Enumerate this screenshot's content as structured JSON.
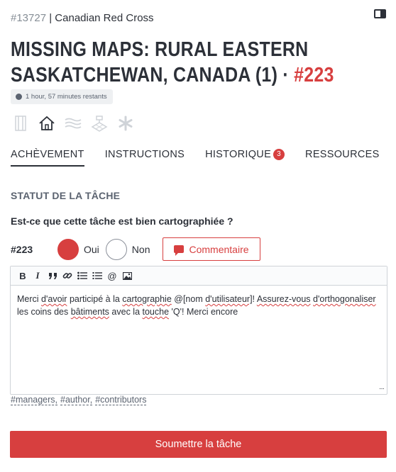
{
  "header": {
    "project_id": "#13727",
    "separator": " | ",
    "organization": "Canadian Red Cross"
  },
  "title": {
    "text": "MISSING MAPS: RURAL EASTERN SASKATCHEWAN, CANADA (1)",
    "dot": " · ",
    "task_number": "#223"
  },
  "timer": {
    "text": "1 hour, 57 minutes restants"
  },
  "icons": [
    "sidebar-icon",
    "home-icon",
    "waves-icon",
    "terrain-icon",
    "asterisk-icon"
  ],
  "tabs": [
    {
      "label": "ACHÈVEMENT",
      "active": true
    },
    {
      "label": "INSTRUCTIONS",
      "active": false
    },
    {
      "label": "HISTORIQUE",
      "badge": "3",
      "active": false
    },
    {
      "label": "RESSOURCES",
      "active": false
    }
  ],
  "status": {
    "section_title": "STATUT DE LA TÂCHE",
    "question": "Est-ce que cette tâche est bien cartographiée ?",
    "task_id": "#223",
    "yes_label": "Oui",
    "no_label": "Non",
    "selected": "Oui",
    "comment_label": "Commentaire"
  },
  "editor": {
    "toolbar": [
      "B",
      "I",
      "99",
      "link",
      "bulleted-list",
      "numbered-list",
      "@",
      "image"
    ],
    "segments": [
      {
        "t": "Merci "
      },
      {
        "t": "d'avoir",
        "spell": true
      },
      {
        "t": " participé à la "
      },
      {
        "t": "cartographie",
        "spell": true
      },
      {
        "t": " @[nom "
      },
      {
        "t": "d'utilisateur]",
        "spell": true
      },
      {
        "t": "! "
      },
      {
        "t": "Assurez-vous",
        "spell": true
      },
      {
        "t": " "
      },
      {
        "t": "d'orthogonaliser",
        "spell": true
      },
      {
        "t": " les coins des "
      },
      {
        "t": "bâtiments",
        "spell": true
      },
      {
        "t": " avec la "
      },
      {
        "t": "touche",
        "spell": true
      },
      {
        "t": " 'Q'! Merci encore"
      }
    ]
  },
  "mentions": [
    "#managers,",
    "#author,",
    "#contributors"
  ],
  "submit_label": "Soumettre la tâche",
  "colors": {
    "accent": "#d73f3f",
    "text": "#2c3038",
    "muted": "#5b6370"
  }
}
